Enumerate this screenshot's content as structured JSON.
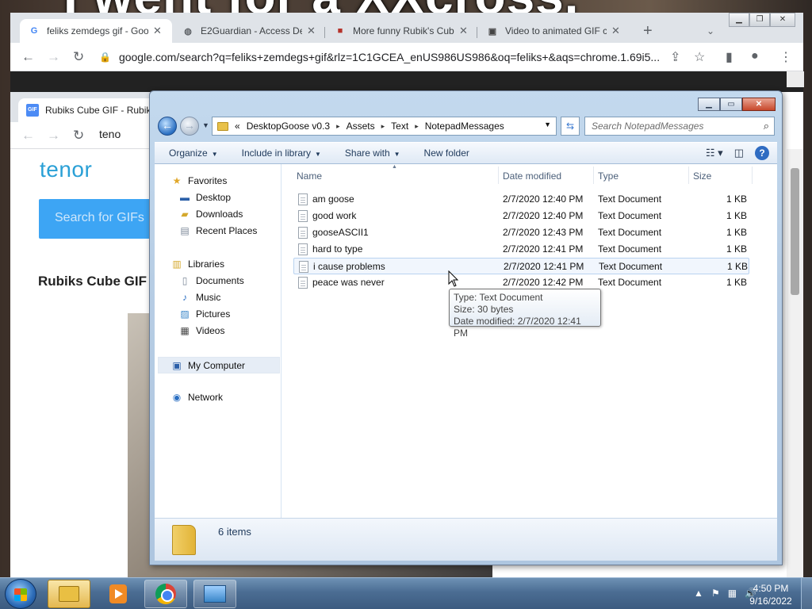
{
  "background": {
    "caption": "I went for a XXcross."
  },
  "chrome_back": {
    "tabs": [
      {
        "icon": "google-icon",
        "title": "feliks zemdegs gif - Goo",
        "active": true
      },
      {
        "icon": "globe-icon",
        "title": "E2Guardian - Access De"
      },
      {
        "icon": "rubiks-cube-icon",
        "title": "More funny Rubik's Cub"
      },
      {
        "icon": "film-icon",
        "title": "Video to animated GIF c"
      }
    ],
    "new_tab": "+",
    "url": "google.com/search?q=feliks+zemdegs+gif&rlz=1C1GCEA_enUS986US986&oq=feliks+&aqs=chrome.1.69i5..."
  },
  "chrome_front": {
    "tab_title": "Rubiks Cube GIF - Rubiks",
    "url": "teno",
    "tenor_logo": "tenor",
    "search_placeholder": "Search for GIFs",
    "heading": "Rubiks Cube GIF"
  },
  "explorer": {
    "breadcrumb": [
      "DesktopGoose v0.3",
      "Assets",
      "Text",
      "NotepadMessages"
    ],
    "breadcrumb_prefix": "«",
    "search_placeholder": "Search NotepadMessages",
    "commands": [
      "Organize",
      "Include in library",
      "Share with",
      "New folder"
    ],
    "nav": {
      "favorites_label": "Favorites",
      "favorites": [
        "Desktop",
        "Downloads",
        "Recent Places"
      ],
      "libraries_label": "Libraries",
      "libraries": [
        "Documents",
        "Music",
        "Pictures",
        "Videos"
      ],
      "computer": "My Computer",
      "network": "Network"
    },
    "columns": [
      "Name",
      "Date modified",
      "Type",
      "Size"
    ],
    "files": [
      {
        "name": "am goose",
        "date": "2/7/2020 12:40 PM",
        "type": "Text Document",
        "size": "1 KB"
      },
      {
        "name": "good work",
        "date": "2/7/2020 12:40 PM",
        "type": "Text Document",
        "size": "1 KB"
      },
      {
        "name": "gooseASCII1",
        "date": "2/7/2020 12:43 PM",
        "type": "Text Document",
        "size": "1 KB"
      },
      {
        "name": "hard to type",
        "date": "2/7/2020 12:41 PM",
        "type": "Text Document",
        "size": "1 KB"
      },
      {
        "name": "i cause problems",
        "date": "2/7/2020 12:41 PM",
        "type": "Text Document",
        "size": "1 KB",
        "hover": true
      },
      {
        "name": "peace was never",
        "date": "2/7/2020 12:42 PM",
        "type": "Text Document",
        "size": "1 KB"
      }
    ],
    "tooltip": {
      "type": "Type: Text Document",
      "size": "Size: 30 bytes",
      "date": "Date modified: 2/7/2020 12:41 PM"
    },
    "item_count": "6 items"
  },
  "taskbar": {
    "time": "4:50 PM",
    "date": "9/16/2022"
  }
}
